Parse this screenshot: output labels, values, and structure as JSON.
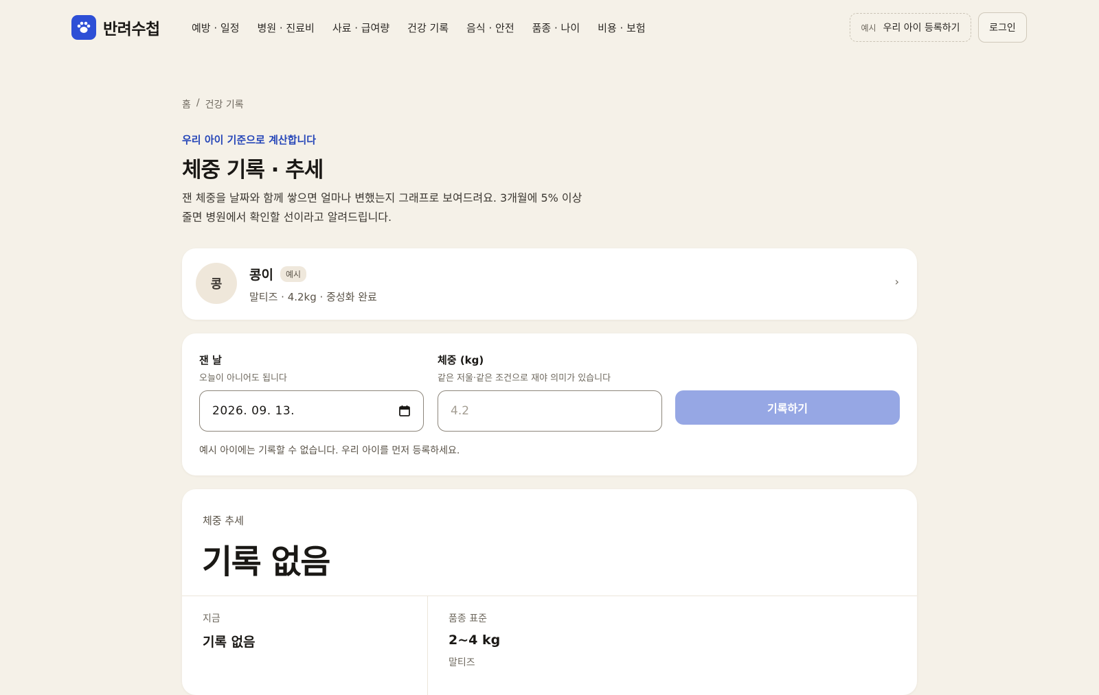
{
  "brand": {
    "name": "반려수첩",
    "logo_icon": "paw-icon",
    "color": "#2d4fd6"
  },
  "nav": {
    "items": [
      "예방 · 일정",
      "병원 · 진료비",
      "사료 · 급여량",
      "건강 기록",
      "음식 · 안전",
      "품종 · 나이",
      "비용 · 보험"
    ]
  },
  "header": {
    "sample_tag": "예시",
    "register_label": "우리 아이 등록하기",
    "login_label": "로그인"
  },
  "breadcrumb": {
    "home": "홈",
    "separator": "/",
    "current": "건강 기록"
  },
  "page": {
    "eyebrow": "우리 아이 기준으로 계산합니다",
    "title": "체중 기록 · 추세",
    "description_line1": "잰 체중을 날짜와 함께 쌓으면 얼마나 변했는지 그래프로 보여드려요. 3개월에 5% 이상",
    "description_line2": "줄면 병원에서 확인할 선이라고 알려드립니다."
  },
  "pet": {
    "avatar_initial": "콩",
    "name": "콩이",
    "badge": "예시",
    "meta": "말티즈 · 4.2kg · 중성화 완료",
    "chevron": "›"
  },
  "form": {
    "date_label": "잰 날",
    "date_hint": "오늘이 아니어도 됩니다",
    "date_value": "2026. 09. 13.",
    "weight_label": "체중 (kg)",
    "weight_hint": "같은 저울·같은 조건으로 재야 의미가 있습니다",
    "weight_placeholder": "4.2",
    "submit_label": "기록하기",
    "note": "예시 아이에는 기록할 수 없습니다. 우리 아이를 먼저 등록하세요."
  },
  "trend": {
    "label": "체중 추세",
    "status": "기록 없음",
    "current_label": "지금",
    "current_value": "기록 없음",
    "standard_label": "품종 표준",
    "standard_value": "2~4 kg",
    "standard_breed": "말티즈"
  }
}
